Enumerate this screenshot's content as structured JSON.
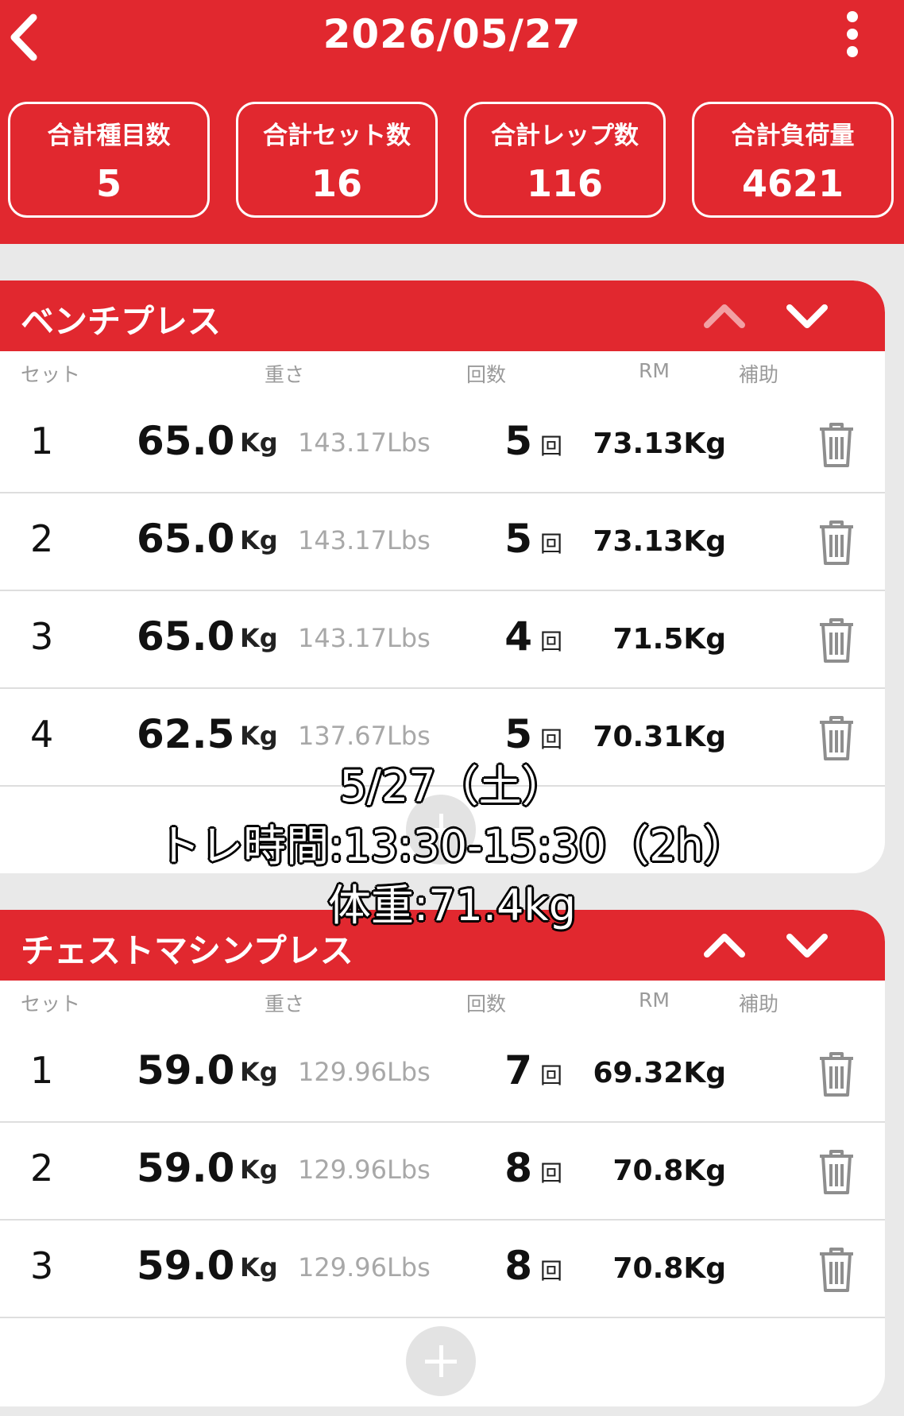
{
  "header": {
    "date": "2026/05/27",
    "stats": [
      {
        "label": "合計種目数",
        "value": "5"
      },
      {
        "label": "合計セット数",
        "value": "16"
      },
      {
        "label": "合計レップ数",
        "value": "116"
      },
      {
        "label": "合計負荷量",
        "value": "4621"
      }
    ]
  },
  "columns": {
    "set": "セット",
    "weight": "重さ",
    "reps": "回数",
    "rm": "RM",
    "assist": "補助"
  },
  "exercises": [
    {
      "name": "ベンチプレス",
      "rows": [
        {
          "set": "1",
          "weight": "65.0",
          "unit": "Kg",
          "lbs": "143.17Lbs",
          "reps": "5",
          "reps_unit": "回",
          "rm": "73.13Kg"
        },
        {
          "set": "2",
          "weight": "65.0",
          "unit": "Kg",
          "lbs": "143.17Lbs",
          "reps": "5",
          "reps_unit": "回",
          "rm": "73.13Kg"
        },
        {
          "set": "3",
          "weight": "65.0",
          "unit": "Kg",
          "lbs": "143.17Lbs",
          "reps": "4",
          "reps_unit": "回",
          "rm": "71.5Kg"
        },
        {
          "set": "4",
          "weight": "62.5",
          "unit": "Kg",
          "lbs": "137.67Lbs",
          "reps": "5",
          "reps_unit": "回",
          "rm": "70.31Kg"
        }
      ]
    },
    {
      "name": "チェストマシンプレス",
      "rows": [
        {
          "set": "1",
          "weight": "59.0",
          "unit": "Kg",
          "lbs": "129.96Lbs",
          "reps": "7",
          "reps_unit": "回",
          "rm": "69.32Kg"
        },
        {
          "set": "2",
          "weight": "59.0",
          "unit": "Kg",
          "lbs": "129.96Lbs",
          "reps": "8",
          "reps_unit": "回",
          "rm": "70.8Kg"
        },
        {
          "set": "3",
          "weight": "59.0",
          "unit": "Kg",
          "lbs": "129.96Lbs",
          "reps": "8",
          "reps_unit": "回",
          "rm": "70.8Kg"
        }
      ]
    }
  ],
  "overlay": {
    "line1": "5/27（土）",
    "line2": "トレ時間:13:30-15:30（2h）",
    "line3": "体重:71.4kg"
  },
  "colors": {
    "accent": "#e1282f",
    "muted_chevron": "#f2a0a3"
  }
}
